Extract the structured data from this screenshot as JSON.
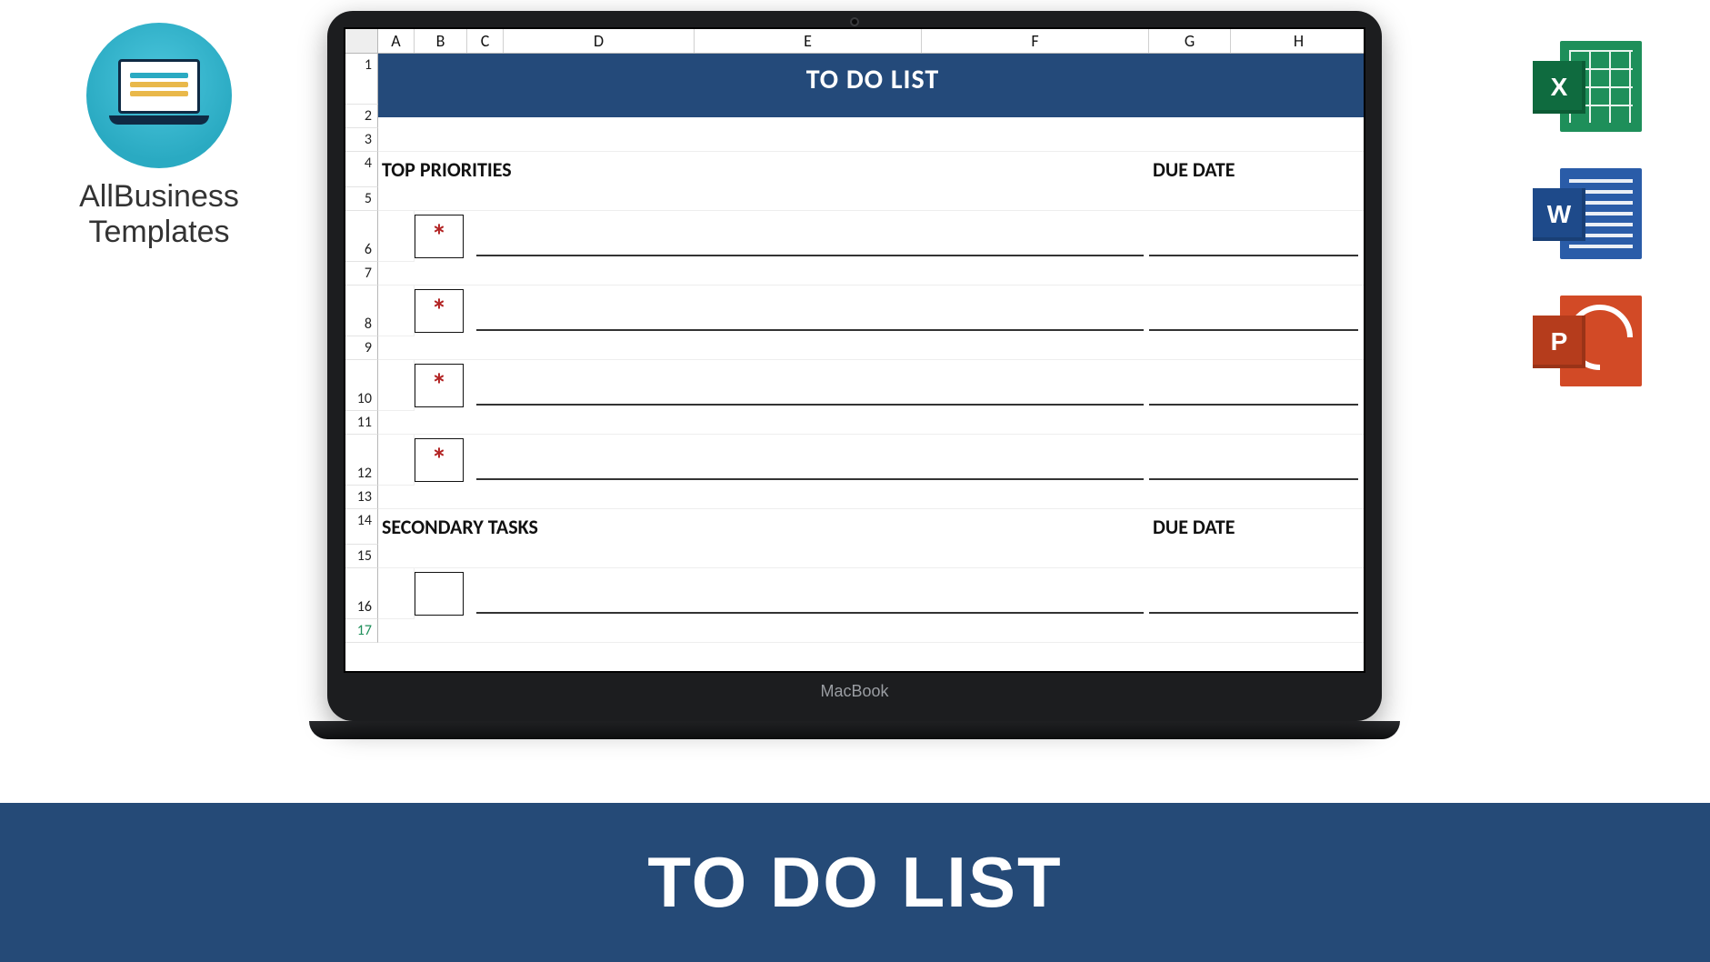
{
  "brand": {
    "line1": "AllBusiness",
    "line2": "Templates"
  },
  "office": {
    "excel": "X",
    "word": "W",
    "ppt": "P"
  },
  "laptop": {
    "label": "MacBook"
  },
  "banner": {
    "title": "TO DO LIST"
  },
  "sheet": {
    "columns": [
      "",
      "A",
      "B",
      "C",
      "D",
      "E",
      "F",
      "G",
      "H"
    ],
    "title": "TO DO LIST",
    "rows": [
      "1",
      "2",
      "3",
      "4",
      "5",
      "6",
      "7",
      "8",
      "9",
      "10",
      "11",
      "12",
      "13",
      "14",
      "15",
      "16",
      "17"
    ],
    "section1": {
      "label": "TOP PRIORITIES",
      "due": "DUE DATE"
    },
    "section2": {
      "label": "SECONDARY TASKS",
      "due": "DUE DATE"
    },
    "priority_mark": "*"
  }
}
